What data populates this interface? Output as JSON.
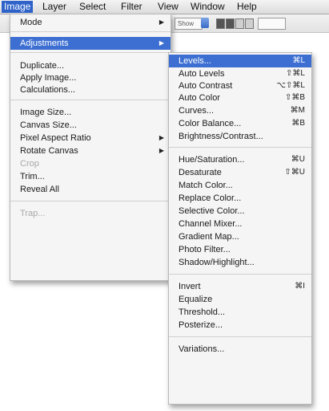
{
  "menubar": {
    "items": [
      {
        "label": "Image",
        "active": true
      },
      {
        "label": "Layer",
        "active": false
      },
      {
        "label": "Select",
        "active": false
      },
      {
        "label": "Filter",
        "active": false
      },
      {
        "label": "View",
        "active": false
      },
      {
        "label": "Window",
        "active": false
      },
      {
        "label": "Help",
        "active": false
      }
    ]
  },
  "optbar": {
    "mode_value": "Show"
  },
  "image_menu": {
    "mode": "Mode",
    "adjustments": "Adjustments",
    "duplicate": "Duplicate...",
    "apply_image": "Apply Image...",
    "calculations": "Calculations...",
    "image_size": "Image Size...",
    "canvas_size": "Canvas Size...",
    "pixel_aspect_ratio": "Pixel Aspect Ratio",
    "rotate_canvas": "Rotate Canvas",
    "crop": "Crop",
    "trim": "Trim...",
    "reveal_all": "Reveal All",
    "trap": "Trap..."
  },
  "adjustments_menu": {
    "items": [
      {
        "label": "Levels...",
        "shortcut": "⌘L"
      },
      {
        "label": "Auto Levels",
        "shortcut": "⇧⌘L"
      },
      {
        "label": "Auto Contrast",
        "shortcut": "⌥⇧⌘L"
      },
      {
        "label": "Auto Color",
        "shortcut": "⇧⌘B"
      },
      {
        "label": "Curves...",
        "shortcut": "⌘M"
      },
      {
        "label": "Color Balance...",
        "shortcut": "⌘B"
      },
      {
        "label": "Brightness/Contrast...",
        "shortcut": ""
      },
      {
        "label": "Hue/Saturation...",
        "shortcut": "⌘U"
      },
      {
        "label": "Desaturate",
        "shortcut": "⇧⌘U"
      },
      {
        "label": "Match Color...",
        "shortcut": ""
      },
      {
        "label": "Replace Color...",
        "shortcut": ""
      },
      {
        "label": "Selective Color...",
        "shortcut": ""
      },
      {
        "label": "Channel Mixer...",
        "shortcut": ""
      },
      {
        "label": "Gradient Map...",
        "shortcut": ""
      },
      {
        "label": "Photo Filter...",
        "shortcut": ""
      },
      {
        "label": "Shadow/Highlight...",
        "shortcut": ""
      },
      {
        "label": "Invert",
        "shortcut": "⌘I"
      },
      {
        "label": "Equalize",
        "shortcut": ""
      },
      {
        "label": "Threshold...",
        "shortcut": ""
      },
      {
        "label": "Posterize...",
        "shortcut": ""
      },
      {
        "label": "Variations...",
        "shortcut": ""
      }
    ]
  },
  "colors": {
    "selection": "#3d6fd2",
    "disabled": "#a8a8a8"
  }
}
